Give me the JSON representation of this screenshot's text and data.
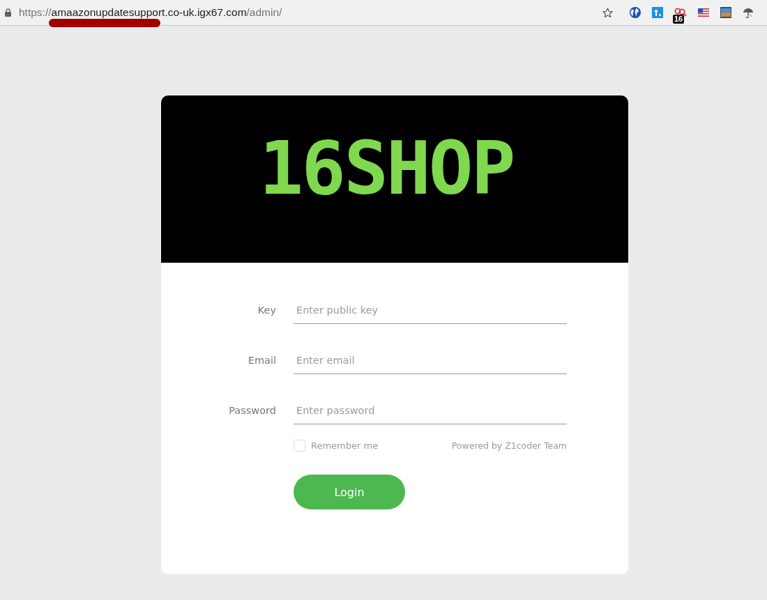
{
  "browser": {
    "url": [
      {
        "text": "https://",
        "kind": "scheme"
      },
      {
        "text": "amaazonupdatesupport.co-uk.igx67.com",
        "kind": "host"
      },
      {
        "text": "/admin/",
        "kind": "path"
      }
    ],
    "bookmarked": false,
    "extension_badge": "16"
  },
  "banner": {
    "logo": "16SHOP"
  },
  "fields": [
    {
      "label": "Key",
      "placeholder": "Enter public key"
    },
    {
      "label": "Email",
      "placeholder": "Enter email"
    },
    {
      "label": "Password",
      "placeholder": "Enter password"
    }
  ],
  "remember": {
    "label": "Remember me",
    "checked": false
  },
  "powered_by": "Powered by Z1coder Team",
  "login_button": "Login"
}
